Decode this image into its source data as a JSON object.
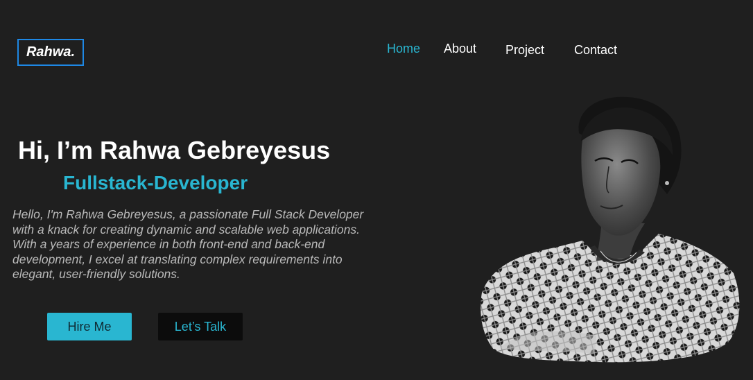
{
  "brand": {
    "logo_text": "Rahwa."
  },
  "nav": {
    "items": [
      {
        "label": "Home",
        "active": true
      },
      {
        "label": "About",
        "active": false
      },
      {
        "label": "Project",
        "active": false
      },
      {
        "label": "Contact",
        "active": false
      }
    ]
  },
  "hero": {
    "greeting": "Hi, I’m Rahwa Gebreyesus",
    "role": "Fullstack-Developer",
    "description": "Hello, I'm Rahwa Gebreyesus, a passionate Full Stack Developer with a knack for creating dynamic and scalable web applications. With a years of experience in both front-end and back-end development, I excel at translating complex requirements into elegant, user-friendly solutions.",
    "primary_button": "Hire Me",
    "secondary_button": "Let’s Talk"
  },
  "colors": {
    "background": "#1f1f1f",
    "accent": "#29b6d1",
    "logo_border": "#1e88e5",
    "text_muted": "#b9b9b9"
  },
  "icons": {
    "portrait": "portrait-photo"
  }
}
